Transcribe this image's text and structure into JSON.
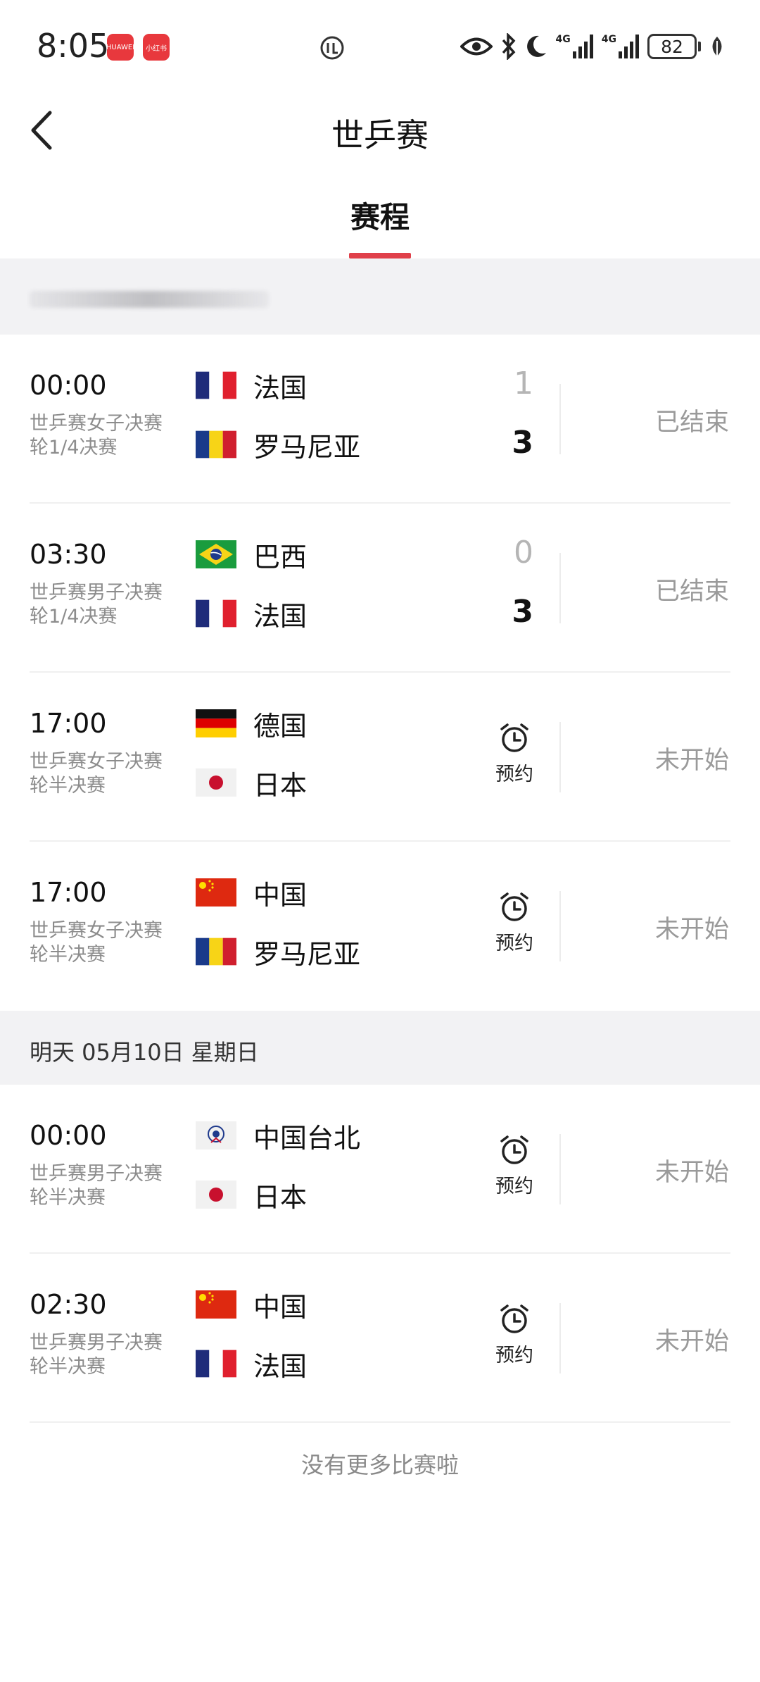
{
  "status_bar": {
    "time": "8:05",
    "apps": [
      {
        "name": "huawei-app-icon",
        "label": "HUAWEI"
      },
      {
        "name": "xiaohongshu-app-icon",
        "label": "小红书"
      }
    ],
    "network": [
      "4G",
      "4G"
    ],
    "battery": "82",
    "icons": [
      "eye-icon",
      "bluetooth-icon",
      "moon-icon",
      "signal-icon",
      "battery-icon",
      "leaf-icon"
    ]
  },
  "header": {
    "title": "世乒赛",
    "back_icon": "chevron-left-icon"
  },
  "tabs": [
    {
      "label": "赛程",
      "active": true
    }
  ],
  "accent_color": "#e0404a",
  "sections": [
    {
      "date": "",
      "matches": [
        {
          "time": "00:00",
          "round": "世乒赛女子决赛轮1/4决赛",
          "team1": {
            "name": "法国",
            "flag": "france"
          },
          "team2": {
            "name": "罗马尼亚",
            "flag": "romania"
          },
          "score1": "1",
          "score2": "3",
          "status": "已结束"
        },
        {
          "time": "03:30",
          "round": "世乒赛男子决赛轮1/4决赛",
          "team1": {
            "name": "巴西",
            "flag": "brazil"
          },
          "team2": {
            "name": "法国",
            "flag": "france"
          },
          "score1": "0",
          "score2": "3",
          "status": "已结束"
        },
        {
          "time": "17:00",
          "round": "世乒赛女子决赛轮半决赛",
          "team1": {
            "name": "德国",
            "flag": "germany"
          },
          "team2": {
            "name": "日本",
            "flag": "japan"
          },
          "remind": "预约",
          "status": "未开始"
        },
        {
          "time": "17:00",
          "round": "世乒赛女子决赛轮半决赛",
          "team1": {
            "name": "中国",
            "flag": "china"
          },
          "team2": {
            "name": "罗马尼亚",
            "flag": "romania"
          },
          "remind": "预约",
          "status": "未开始"
        }
      ]
    },
    {
      "date": "明天 05月10日 星期日",
      "matches": [
        {
          "time": "00:00",
          "round": "世乒赛男子决赛轮半决赛",
          "team1": {
            "name": "中国台北",
            "flag": "chinese-taipei"
          },
          "team2": {
            "name": "日本",
            "flag": "japan"
          },
          "remind": "预约",
          "status": "未开始"
        },
        {
          "time": "02:30",
          "round": "世乒赛男子决赛轮半决赛",
          "team1": {
            "name": "中国",
            "flag": "china"
          },
          "team2": {
            "name": "法国",
            "flag": "france"
          },
          "remind": "预约",
          "status": "未开始"
        }
      ]
    }
  ],
  "footer_text": "没有更多比赛啦"
}
